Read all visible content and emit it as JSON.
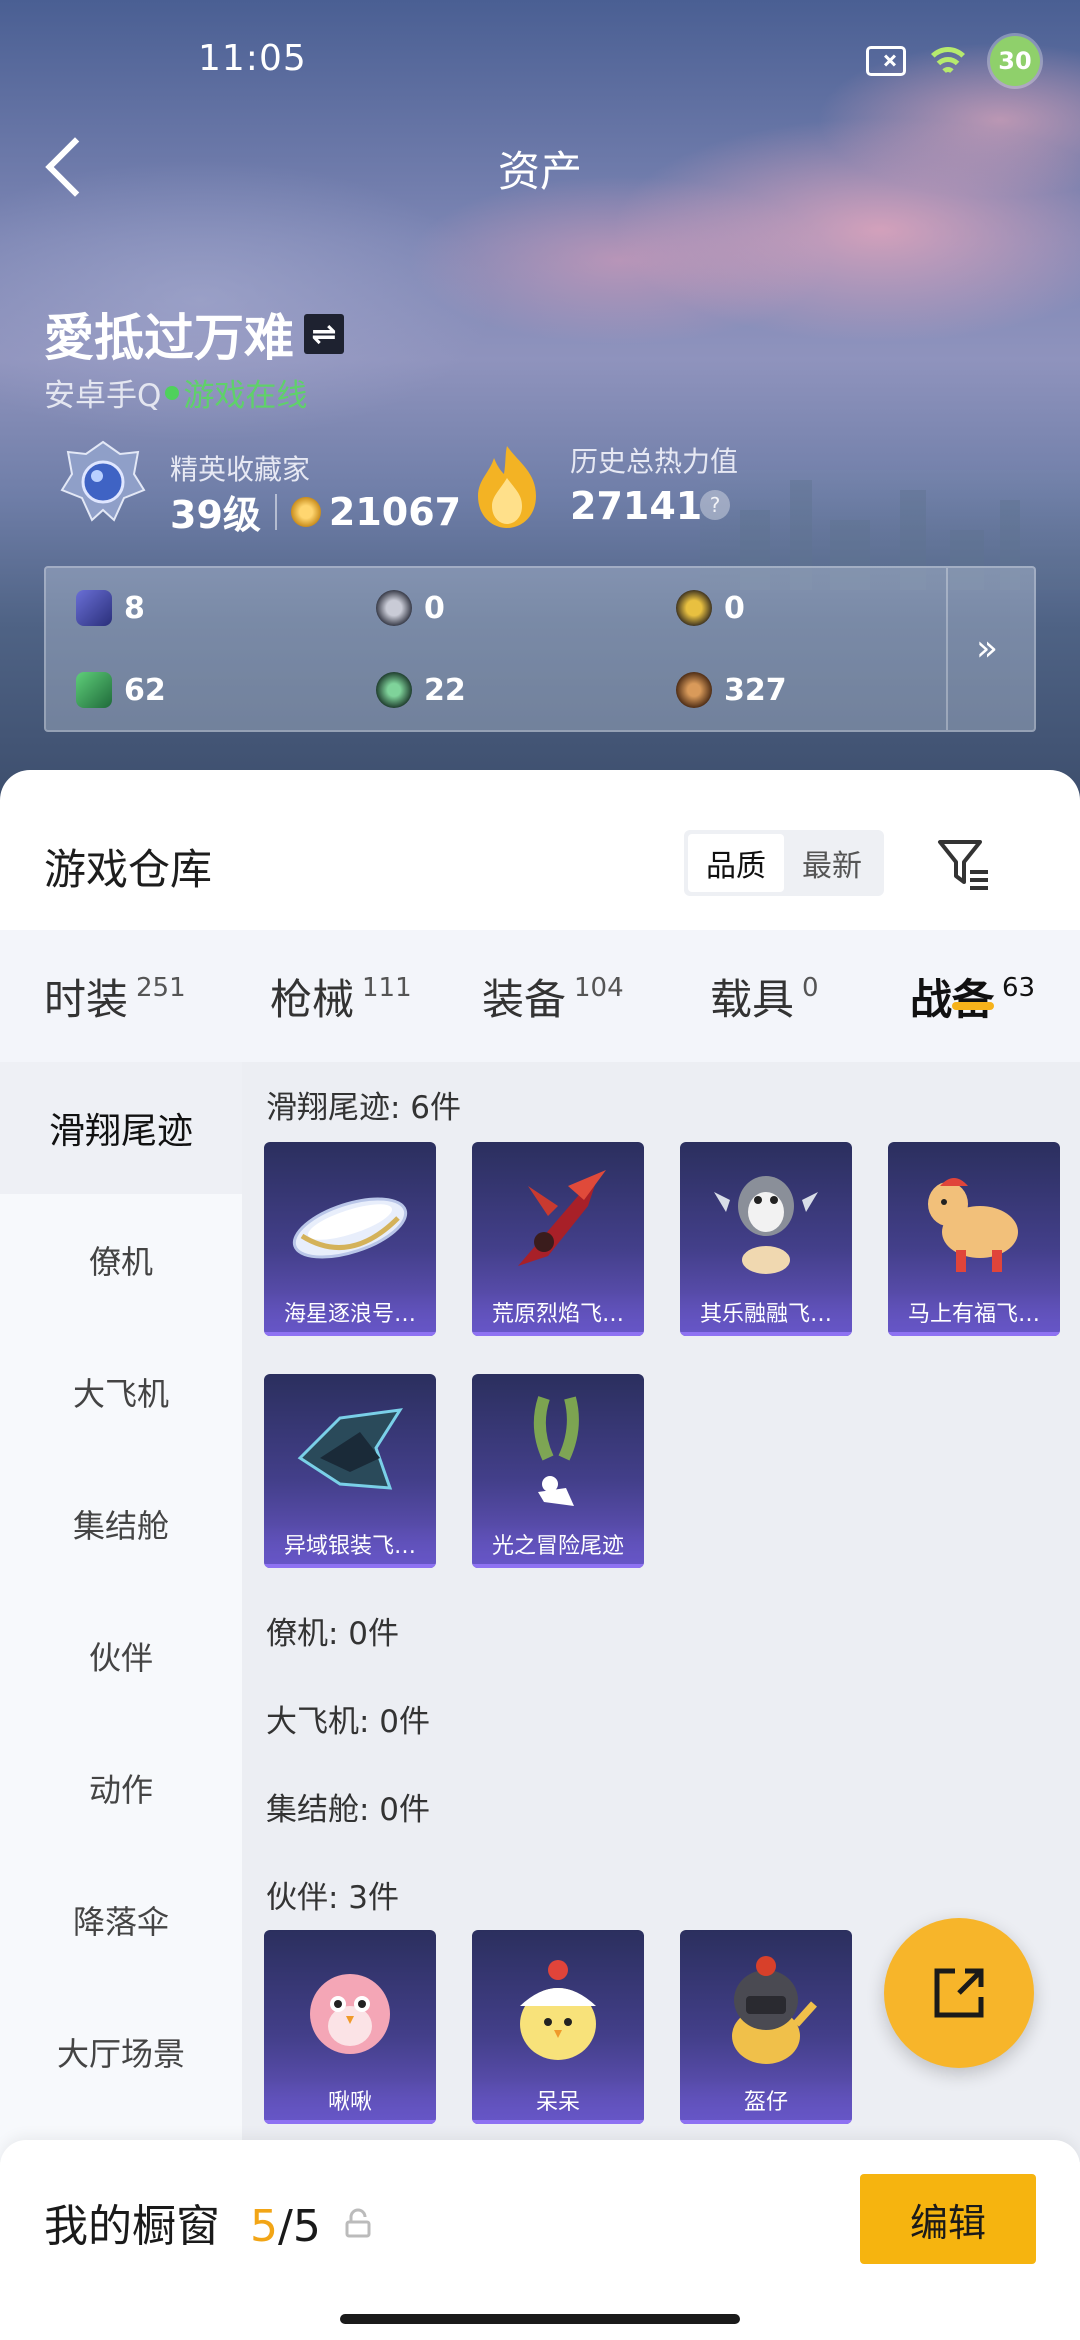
{
  "status_bar": {
    "time": "11:05",
    "battery": "30"
  },
  "header": {
    "title": "资产"
  },
  "profile": {
    "name": "愛抵过万难",
    "platform": "安卓手Q",
    "online_status": "游戏在线",
    "rank_title": "精英收藏家",
    "level": "39级",
    "collection_points": "21067",
    "heat_title": "历史总热力值",
    "heat_value": "27141",
    "help": "?"
  },
  "currencies": {
    "row1": [
      "8",
      "0",
      "0"
    ],
    "row2": [
      "62",
      "22",
      "327"
    ],
    "more": "»"
  },
  "warehouse": {
    "title": "游戏仓库",
    "sort_options": [
      "品质",
      "最新"
    ],
    "active_sort": "品质"
  },
  "categories": [
    {
      "label": "时装",
      "count": "251"
    },
    {
      "label": "枪械",
      "count": "111"
    },
    {
      "label": "装备",
      "count": "104"
    },
    {
      "label": "载具",
      "count": "0"
    },
    {
      "label": "战备",
      "count": "63"
    }
  ],
  "active_category": "战备",
  "side_nav": [
    "滑翔尾迹",
    "僚机",
    "大飞机",
    "集结舱",
    "伙伴",
    "动作",
    "降落伞",
    "大厅场景"
  ],
  "sections": {
    "glide_trail": {
      "title": "滑翔尾迹: 6件",
      "items": [
        "海星逐浪号…",
        "荒原烈焰飞…",
        "其乐融融飞…",
        "马上有福飞…",
        "异域银装飞…",
        "光之冒险尾迹"
      ]
    },
    "wingman": {
      "title": "僚机: 0件"
    },
    "big_plane": {
      "title": "大飞机: 0件"
    },
    "pod": {
      "title": "集结舱: 0件"
    },
    "companion": {
      "title": "伙伴: 3件",
      "items": [
        "啾啾",
        "呆呆",
        "盔仔"
      ]
    }
  },
  "showcase": {
    "title": "我的橱窗",
    "current": "5",
    "separator": "/",
    "total": "5",
    "edit_label": "编辑"
  },
  "colors": {
    "accent": "#f6b40f",
    "online": "#5fd16a",
    "card": "#433f8a"
  }
}
